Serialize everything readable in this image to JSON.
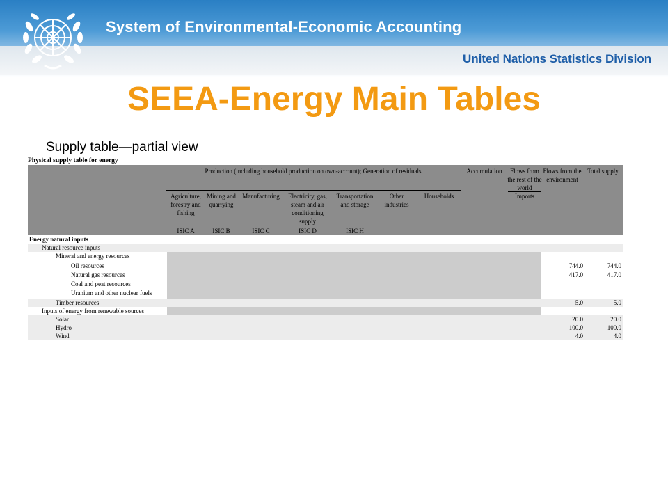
{
  "header": {
    "system_title": "System of Environmental-Economic Accounting",
    "division": "United Nations Statistics Division",
    "logo_icon": "un-emblem-icon",
    "band_color": "#2a7fc4"
  },
  "slide": {
    "title": "SEEA-Energy Main Tables",
    "title_color": "#f39a12",
    "subtitle": "Supply table—partial view"
  },
  "table": {
    "title": "Physical supply table for energy",
    "group_header": "Production (including household production on own-account); Generation of residuals",
    "columns": {
      "agriculture": "Agriculture, forestry and fishing",
      "mining": "Mining and quarrying",
      "manufacturing": "Manufacturing",
      "electricity": "Electricity, gas, steam and air conditioning supply",
      "transport": "Transportation and storage",
      "other": "Other industries",
      "households": "Households",
      "accumulation": "Accumulation",
      "flows_row": "Flows from the rest of the world",
      "imports": "Imports",
      "flows_env": "Flows from the environment",
      "total": "Total supply"
    },
    "isic": {
      "a": "ISIC A",
      "b": "ISIC B",
      "c": "ISIC C",
      "d": "ISIC D",
      "h": "ISIC H"
    },
    "rows": [
      {
        "label": "Energy natural inputs",
        "env": "",
        "total": ""
      },
      {
        "label": "Natural resource inputs",
        "env": "",
        "total": ""
      },
      {
        "label": "Mineral and energy resources",
        "env": "",
        "total": ""
      },
      {
        "label": "Oil resources",
        "env": "744.0",
        "total": "744.0"
      },
      {
        "label": "Natural gas resources",
        "env": "417.0",
        "total": "417.0"
      },
      {
        "label": "Coal and peat resources",
        "env": "",
        "total": ""
      },
      {
        "label": "Uranium and other nuclear fuels",
        "env": "",
        "total": ""
      },
      {
        "label": "Timber resources",
        "env": "5.0",
        "total": "5.0"
      },
      {
        "label": "Inputs of energy from renewable sources",
        "env": "",
        "total": ""
      },
      {
        "label": "Solar",
        "env": "20.0",
        "total": "20.0"
      },
      {
        "label": "Hydro",
        "env": "100.0",
        "total": "100.0"
      },
      {
        "label": "Wind",
        "env": "4.0",
        "total": "4.0"
      }
    ]
  }
}
